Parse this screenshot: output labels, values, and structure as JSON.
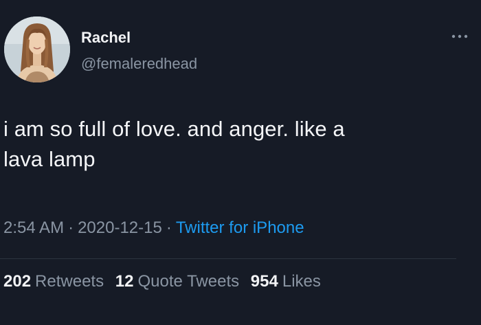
{
  "author": {
    "name": "Rachel",
    "handle": "@femaleredhead"
  },
  "tweet": {
    "text_line1": "i am so full of love. and anger. like a",
    "text_line2": "lava lamp"
  },
  "meta": {
    "time": "2:54 AM",
    "separator": "·",
    "date": "2020-12-15",
    "source": "Twitter for iPhone"
  },
  "stats": {
    "retweets_count": "202",
    "retweets_label": "Retweets",
    "quotes_count": "12",
    "quotes_label": "Quote Tweets",
    "likes_count": "954",
    "likes_label": "Likes"
  },
  "icons": {
    "more": "more-options-icon",
    "avatar": "profile-photo"
  },
  "colors": {
    "background": "#161b26",
    "link": "#1d9bf0",
    "secondary_text": "#8a95a3"
  }
}
